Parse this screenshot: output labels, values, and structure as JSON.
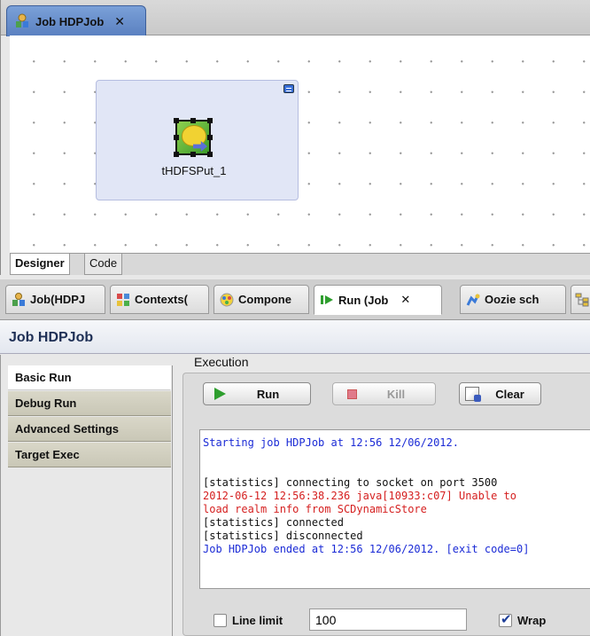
{
  "editor": {
    "tab_label": "Job HDPJob",
    "component_label": "tHDFSPut_1",
    "subtabs": [
      "Designer",
      "Code"
    ]
  },
  "views": {
    "tabs": [
      "Job(HDPJ",
      "Contexts(",
      "Compone",
      "Run (Job",
      "Oozie sch"
    ],
    "title": "Job HDPJob",
    "left_tabs": [
      "Basic Run",
      "Debug Run",
      "Advanced Settings",
      "Target Exec"
    ],
    "execution_label": "Execution",
    "buttons": {
      "run": "Run",
      "kill": "Kill",
      "clear": "Clear"
    },
    "console": {
      "lines": [
        {
          "text": "Starting job HDPJob at 12:56 12/06/2012.",
          "color": "blue"
        },
        {
          "text": "",
          "color": "black"
        },
        {
          "text": "",
          "color": "black"
        },
        {
          "text": "[statistics] connecting to socket on port 3500",
          "color": "black"
        },
        {
          "text": "2012-06-12 12:56:38.236 java[10933:c07] Unable to",
          "color": "red"
        },
        {
          "text": "load realm info from SCDynamicStore",
          "color": "red"
        },
        {
          "text": "[statistics] connected",
          "color": "black"
        },
        {
          "text": "[statistics] disconnected",
          "color": "black"
        },
        {
          "text": "Job HDPJob ended at 12:56 12/06/2012. [exit code=0]",
          "color": "blue"
        }
      ]
    },
    "line_limit_label": "Line limit",
    "line_limit_value": "100",
    "wrap_label": "Wrap"
  },
  "colors": {
    "console_blue": "#1b2bd6",
    "console_red": "#d51f1f",
    "editor_tab": "#6a90cc"
  }
}
